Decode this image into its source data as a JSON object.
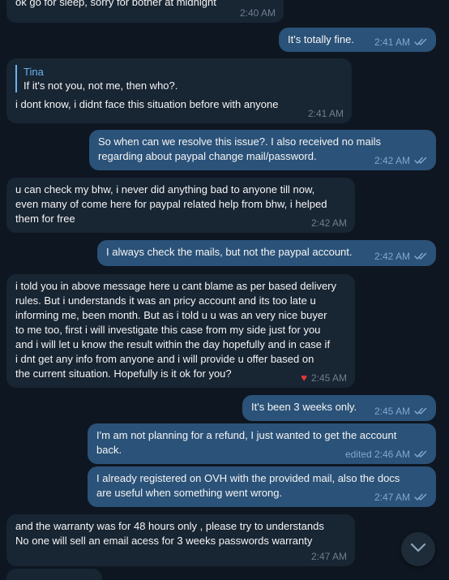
{
  "messages": [
    {
      "text": "ok go for sleep, sorry for bother at midnight",
      "time": "2:40 AM"
    },
    {
      "text": "It's totally fine.",
      "time": "2:41 AM"
    },
    {
      "reply_name": "Tina",
      "reply_text": "If it's not you, not me, then who?.",
      "text": "i dont know, i didnt face this situation before with anyone",
      "time": "2:41 AM"
    },
    {
      "text": "So when can we resolve this issue?. I also received no mails\nregarding about paypal change mail/password.",
      "time": "2:42 AM"
    },
    {
      "text": "u can check my bhw, i never did anything bad to anyone till now,\neven many of come here for paypal related help from bhw, i helped\nthem for free",
      "time": "2:42 AM"
    },
    {
      "text": "I always check the mails, but not the paypal account.",
      "time": "2:42 AM"
    },
    {
      "text": "i told you in above message here u cant blame as per based delivery\nrules. But i understands it was an pricy account and its too late u\ninforming me, been month. But as i told u u was an very nice buyer\nto me too, first i will investigate this case from my side just for you\nand i will let u know the result within the day hopefully and in case if\ni dnt get any info from anyone and i will provide u offer based on\nthe current situation. Hopefully is it ok for you?",
      "time": "2:45 AM",
      "reaction": "heart"
    },
    {
      "text": "It's been 3 weeks only.",
      "time": "2:45 AM"
    },
    {
      "text": "I'm am not planning for a refund, I just wanted to get the account\nback.",
      "time": "edited 2:46 AM"
    },
    {
      "text": "I already registered on OVH with the provided mail, also the docs\nare useful when something went wrong.",
      "time": "2:47 AM"
    },
    {
      "text": "and the warranty was for 48 hours only , please try to understands\nNo one will sell an email acess for 3 weeks passwords warranty",
      "time": "2:47 AM"
    }
  ],
  "icons": {
    "read_receipt": "double-check-icon",
    "reaction": "heart-icon",
    "scroll_down": "chevron-down-icon"
  },
  "colors": {
    "background": "#0e1621",
    "incoming_bubble": "#182533",
    "outgoing_bubble": "#2b5278",
    "accent": "#6ab2f2",
    "reaction": "#e53935"
  }
}
